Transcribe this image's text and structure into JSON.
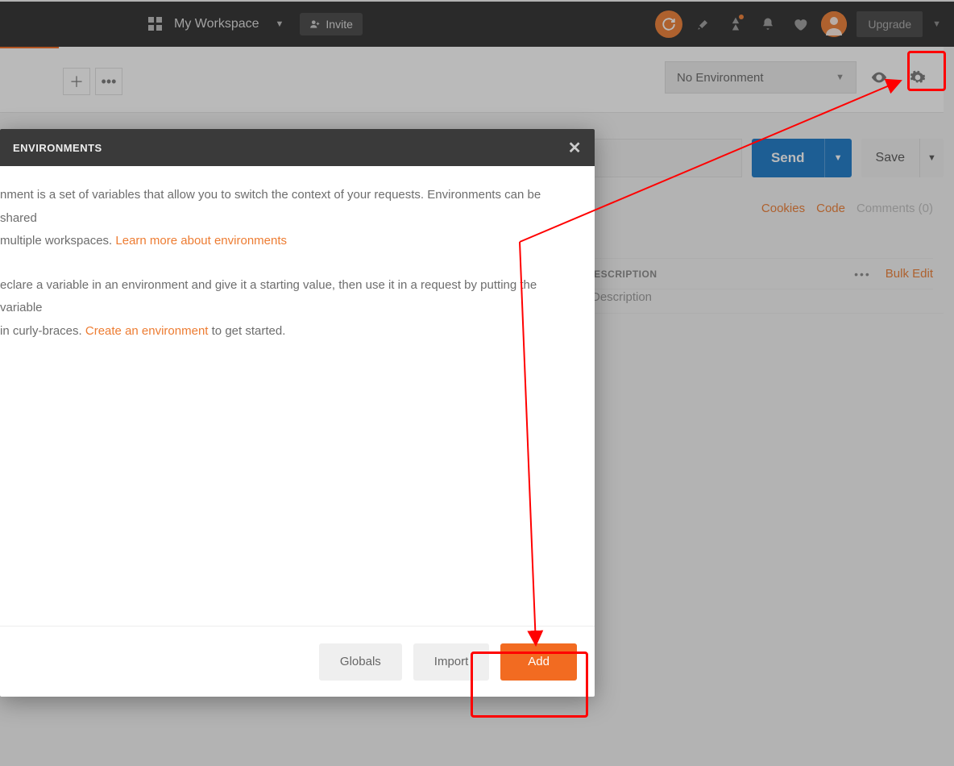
{
  "topbar": {
    "workspace_label": "My Workspace",
    "invite_label": "Invite",
    "upgrade_label": "Upgrade"
  },
  "env": {
    "selector_label": "No Environment"
  },
  "request": {
    "send_label": "Send",
    "save_label": "Save"
  },
  "links": {
    "cookies": "Cookies",
    "code": "Code",
    "comments": "Comments (0)"
  },
  "table": {
    "description_header": "DESCRIPTION",
    "bulk_edit": "Bulk Edit",
    "description_placeholder": "Description"
  },
  "modal": {
    "title": "ENVIRONMENTS",
    "p1a": "nment is a set of variables that allow you to switch the context of your requests. Environments can be shared",
    "p1b": "multiple workspaces. ",
    "learn_link": "Learn more about environments",
    "p2a": "eclare a variable in an environment and give it a starting value, then use it in a request by putting the variable",
    "p2b": "in curly-braces. ",
    "create_link": "Create an environment",
    "p2c": " to get started.",
    "globals_btn": "Globals",
    "import_btn": "Import",
    "add_btn": "Add"
  }
}
